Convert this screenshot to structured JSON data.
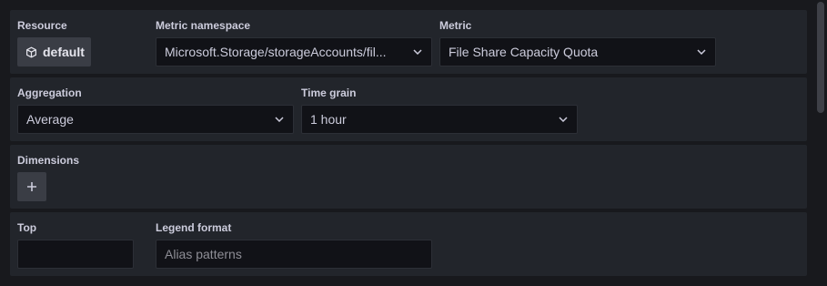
{
  "resource": {
    "label": "Resource",
    "button_label": "default",
    "icon": "cube-icon"
  },
  "metric_namespace": {
    "label": "Metric namespace",
    "value": "Microsoft.Storage/storageAccounts/fil..."
  },
  "metric": {
    "label": "Metric",
    "value": "File Share Capacity Quota"
  },
  "aggregation": {
    "label": "Aggregation",
    "value": "Average"
  },
  "time_grain": {
    "label": "Time grain",
    "value": "1 hour"
  },
  "dimensions": {
    "label": "Dimensions",
    "add_icon": "plus-icon"
  },
  "top": {
    "label": "Top",
    "value": ""
  },
  "legend_format": {
    "label": "Legend format",
    "placeholder": "Alias patterns"
  },
  "colors": {
    "background": "#18191d",
    "panel": "#22252b",
    "input_bg": "#111217",
    "button_bg": "#3a3d45",
    "text": "#ccccdc"
  }
}
